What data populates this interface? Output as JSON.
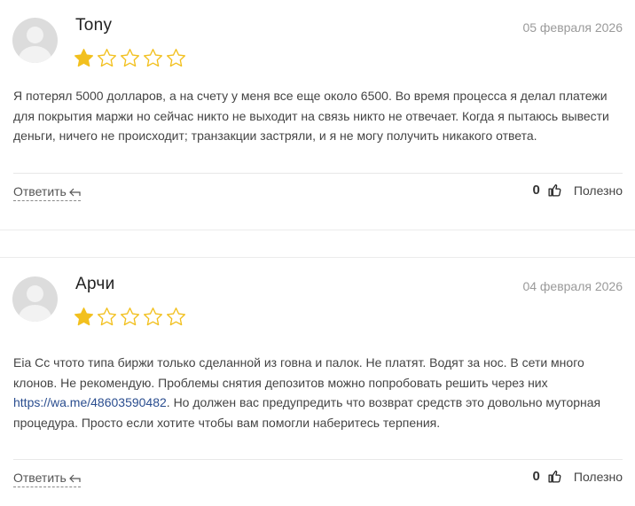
{
  "reviews": [
    {
      "author": "Tony",
      "date": "05 февраля 2026",
      "rating": 1,
      "max_rating": 5,
      "text": "Я потерял 5000 долларов, а на счету у меня все еще около 6500. Во время процесса я делал платежи для покрытия маржи но сейчас никто не выходит на связь никто не отвечает. Когда я пытаюсь вывести деньги, ничего не происходит; транзакции застряли, и я не могу получить никакого ответа.",
      "reply_label": "Ответить",
      "votes": "0",
      "useful_label": "Полезно"
    },
    {
      "author": "Арчи",
      "date": "04 февраля 2026",
      "rating": 1,
      "max_rating": 5,
      "text_before_link": "Eia Cc чтото типа биржи только сделанной из говна и палок. Не платят. Водят за нос. В сети много клонов. Не рекомендую. Проблемы снятия депозитов можно попробовать решить через них ",
      "link": "https://wa.me/48603590482",
      "text_after_link": ". Но должен вас предупредить что возврат средств это довольно муторная процедура. Просто если хотите чтобы вам помогли наберитесь терпения.",
      "reply_label": "Ответить",
      "votes": "0",
      "useful_label": "Полезно"
    }
  ],
  "colors": {
    "star_filled": "#f2c01e",
    "star_empty_stroke": "#f2c01e",
    "link": "#2a4d8f",
    "date": "#9a9a9a"
  },
  "icons": {
    "star": "star-icon",
    "reply": "reply-arrow-icon",
    "thumb": "thumbs-up-icon",
    "avatar": "user-avatar-placeholder"
  }
}
